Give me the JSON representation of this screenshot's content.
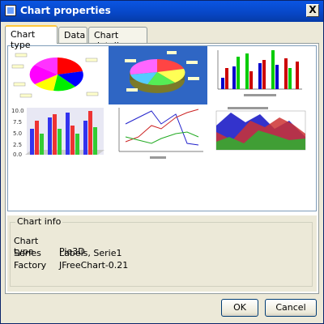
{
  "window": {
    "title": "Chart properties",
    "close_glyph": "X"
  },
  "tabs": [
    {
      "label": "Chart type",
      "active": true
    },
    {
      "label": "Data",
      "active": false
    },
    {
      "label": "Chart details",
      "active": false
    }
  ],
  "chart_types": [
    {
      "name": "pie",
      "selected": false
    },
    {
      "name": "pie3d",
      "selected": true
    },
    {
      "name": "bar",
      "selected": false
    },
    {
      "name": "bar3d",
      "selected": false
    },
    {
      "name": "line",
      "selected": false
    },
    {
      "name": "area",
      "selected": false
    }
  ],
  "thumb_texts": {
    "bar3d_ticks": [
      "10.0",
      "7.5",
      "5.0",
      "2.5",
      "0.0"
    ]
  },
  "chart_info": {
    "legend": "Chart info",
    "rows": [
      {
        "key": "Chart type",
        "value": "Pie3D"
      },
      {
        "key": "Series",
        "value": "Labels, Serie1"
      },
      {
        "key": "Factory",
        "value": "JFreeChart-0.21"
      }
    ]
  },
  "buttons": {
    "ok": "OK",
    "cancel": "Cancel"
  },
  "colors": {
    "title_bar": "#0746c5",
    "selection": "#2f66c4",
    "active_tab_accent": "#ffc73c"
  }
}
